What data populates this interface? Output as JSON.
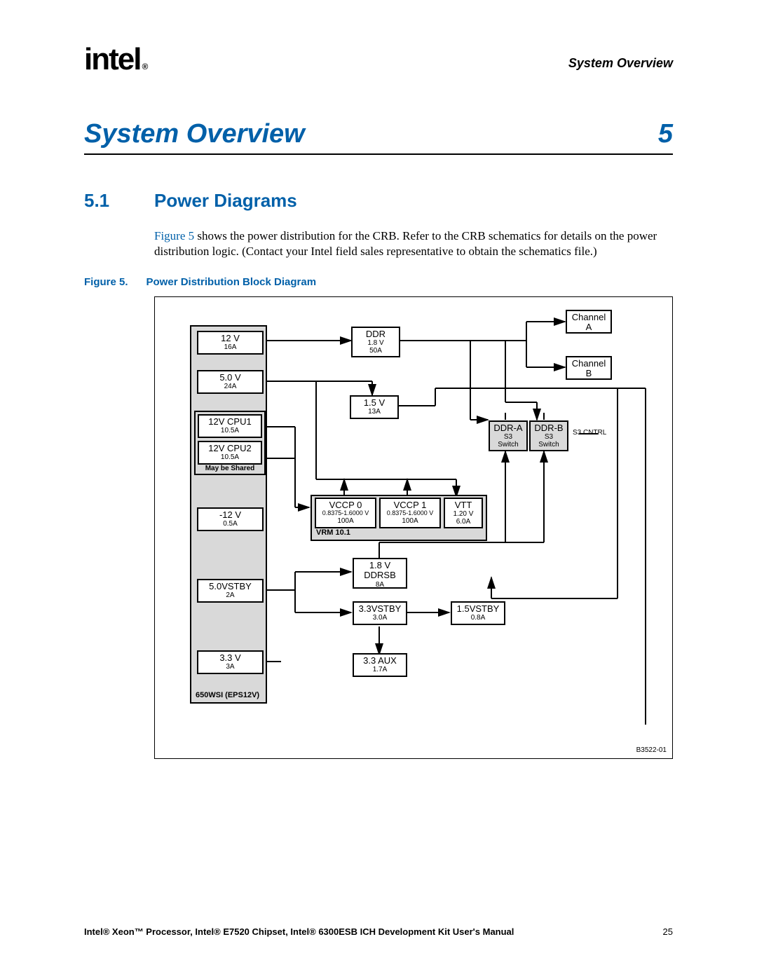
{
  "header": {
    "logo": "intel",
    "reg": "®",
    "right": "System Overview"
  },
  "chapter": {
    "title": "System Overview",
    "num": "5"
  },
  "section": {
    "num": "5.1",
    "title": "Power Diagrams"
  },
  "body": {
    "figref": "Figure 5",
    "rest": " shows the power distribution for the CRB. Refer to the CRB schematics for details on the power distribution logic. (Contact your Intel field sales representative to obtain the schematics file.)"
  },
  "figure": {
    "label": "Figure 5.",
    "caption": "Power Distribution Block Diagram"
  },
  "diagram": {
    "id": "B3522-01",
    "psu_label": "650WSI (EPS12V)",
    "vrm_label": "VRM 10.1",
    "may_be_shared": "May be Shared",
    "s3_cntrl": "S3 CNTRL",
    "blocks": {
      "v12": {
        "l1": "12 V",
        "l2": "16A"
      },
      "v5": {
        "l1": "5.0 V",
        "l2": "24A"
      },
      "cpu1": {
        "l1": "12V CPU1",
        "l2": "10.5A"
      },
      "cpu2": {
        "l1": "12V CPU2",
        "l2": "10.5A"
      },
      "neg12": {
        "l1": "-12 V",
        "l2": "0.5A"
      },
      "stby5": {
        "l1": "5.0VSTBY",
        "l2": "2A"
      },
      "v33": {
        "l1": "3.3 V",
        "l2": "3A"
      },
      "ddr": {
        "l1": "DDR",
        "l2": "1.8 V",
        "l3": "50A"
      },
      "v15": {
        "l1": "1.5 V",
        "l2": "13A"
      },
      "vccp0": {
        "l1": "VCCP 0",
        "l2": "0.8375-1.6000 V",
        "l3": "100A"
      },
      "vccp1": {
        "l1": "VCCP 1",
        "l2": "0.8375-1.6000 V",
        "l3": "100A"
      },
      "vtt": {
        "l1": "VTT",
        "l2": "1.20 V",
        "l3": "6.0A"
      },
      "ddrsb": {
        "l1": "1.8 V",
        "l2": "DDRSB",
        "l3": "8A"
      },
      "stby33": {
        "l1": "3.3VSTBY",
        "l2": "3.0A"
      },
      "stby15": {
        "l1": "1.5VSTBY",
        "l2": "0.8A"
      },
      "aux33": {
        "l1": "3.3 AUX",
        "l2": "1.7A"
      },
      "chanA": {
        "l1": "Channel",
        "l2": "A"
      },
      "chanB": {
        "l1": "Channel",
        "l2": "B"
      },
      "ddra": {
        "l1": "DDR-A",
        "l2": "S3",
        "l3": "Switch"
      },
      "ddrb": {
        "l1": "DDR-B",
        "l2": "S3",
        "l3": "Switch"
      }
    }
  },
  "footer": {
    "text": "Intel® Xeon™ Processor, Intel® E7520 Chipset, Intel® 6300ESB ICH Development Kit User's Manual",
    "page": "25"
  }
}
